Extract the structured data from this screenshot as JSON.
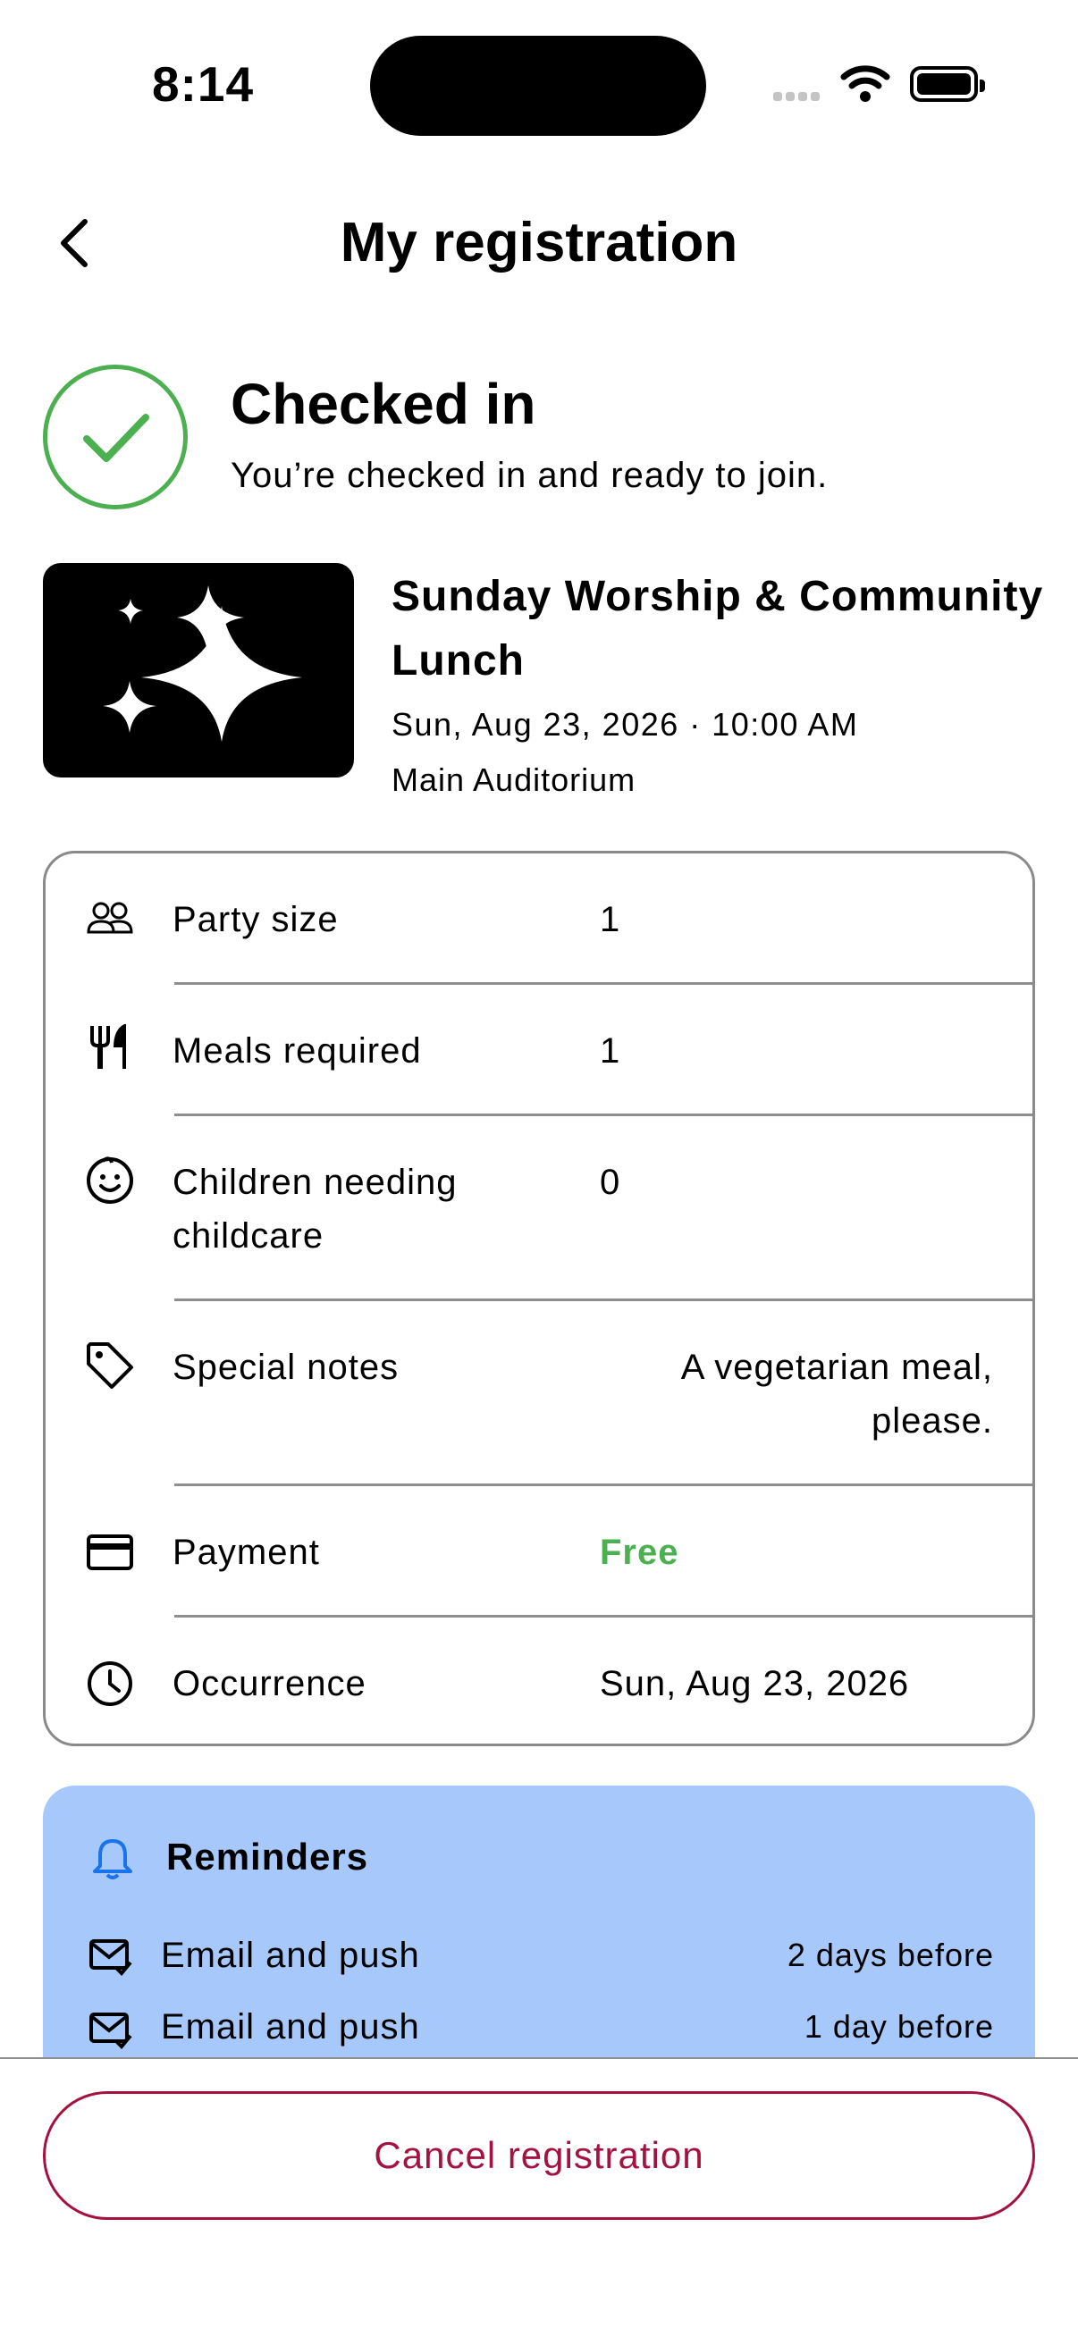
{
  "status_bar": {
    "time": "8:14"
  },
  "header": {
    "title": "My registration"
  },
  "status": {
    "title": "Checked in",
    "subtitle": "You’re checked in and ready to join.",
    "color": "#4caf50"
  },
  "event": {
    "title": "Sunday Worship & Community Lunch",
    "when": "Sun, Aug 23, 2026 · 10:00 AM",
    "where": "Main Auditorium"
  },
  "details": [
    {
      "icon": "people-icon",
      "label": "Party size",
      "value": "1"
    },
    {
      "icon": "utensils-icon",
      "label": "Meals required",
      "value": "1"
    },
    {
      "icon": "child-face-icon",
      "label": "Children needing childcare",
      "value": "0"
    },
    {
      "icon": "tag-icon",
      "label": "Special notes",
      "value": "A vegetarian meal, please."
    },
    {
      "icon": "credit-card-icon",
      "label": "Payment",
      "value": "Free",
      "value_color": "#4caf50"
    },
    {
      "icon": "clock-icon",
      "label": "Occurrence",
      "value": "Sun, Aug 23, 2026"
    }
  ],
  "reminders": {
    "title": "Reminders",
    "items": [
      {
        "icon": "mail-check-icon",
        "label": "Email and push",
        "when": "2 days before"
      },
      {
        "icon": "mail-check-icon",
        "label": "Email and push",
        "when": "1 day before"
      }
    ]
  },
  "actions": {
    "cancel_label": "Cancel registration",
    "cancel_color": "#a4123f"
  }
}
